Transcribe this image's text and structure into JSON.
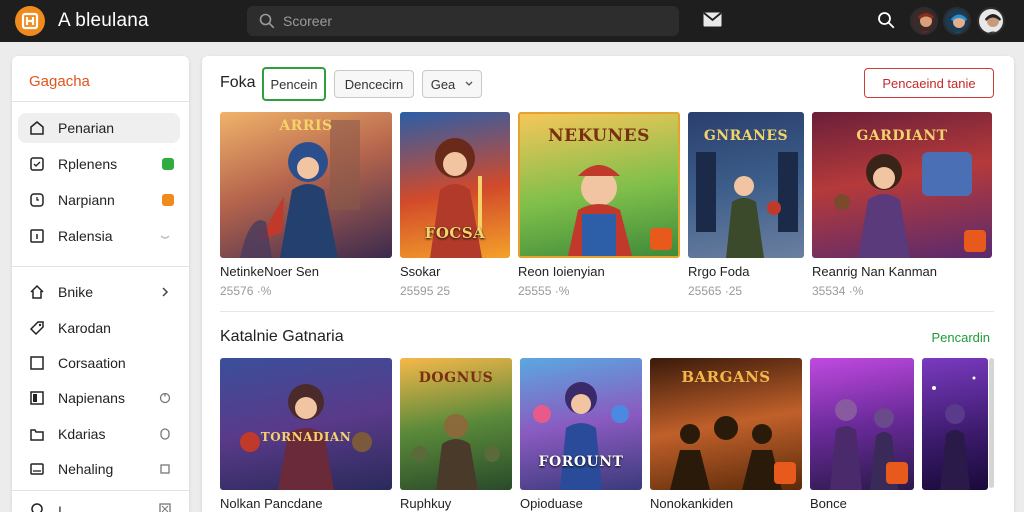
{
  "header": {
    "app_title": "A bleulana",
    "search_placeholder": "Scoreer",
    "icons": [
      "mail-icon",
      "search-icon"
    ],
    "avatars": [
      "avatar-1",
      "avatar-2",
      "avatar-3"
    ]
  },
  "sidebar": {
    "title": "Gagacha",
    "items": [
      {
        "label": "Penarian",
        "icon": "home-icon",
        "active": true
      },
      {
        "label": "Rplenens",
        "icon": "square-check-icon",
        "badge_color": "#2fae3f"
      },
      {
        "label": "Narpiann",
        "icon": "clock-icon",
        "badge_color": "#f08a1c"
      },
      {
        "label": "Ralensia",
        "icon": "info-square-icon",
        "trail": "toggle-icon"
      },
      {
        "label": "Bnike",
        "icon": "house-icon",
        "trail": "chevron-right-icon"
      },
      {
        "label": "Karodan",
        "icon": "tag-icon"
      },
      {
        "label": "Corsaation",
        "icon": "square-icon"
      },
      {
        "label": "Napienans",
        "icon": "book-icon",
        "trail": "refresh-icon"
      },
      {
        "label": "Kdarias",
        "icon": "folder-icon",
        "trail": "circle-icon"
      },
      {
        "label": "Nehaling",
        "icon": "image-icon",
        "trail": "square-outline-icon"
      }
    ],
    "bottom_item": {
      "label": "ı"
    }
  },
  "main": {
    "section1": {
      "title": "Foka",
      "tabs": [
        {
          "label": "Pencein",
          "active": true
        },
        {
          "label": "Dencecirn"
        },
        {
          "label": "Gea",
          "dropdown": true
        }
      ],
      "action_button": "Pencaeind tanie",
      "cards": [
        {
          "name": "NetinkeNoer Sen",
          "meta": "25576 ·%",
          "art": "ARRIS"
        },
        {
          "name": "Ssokar",
          "meta": "25595 25",
          "art": "FOCSA"
        },
        {
          "name": "Reon Ioienyian",
          "meta": "25555 ·%",
          "art": "NEKUNES"
        },
        {
          "name": "Rrgo Foda",
          "meta": "25565 ·25",
          "art": "GNRANES"
        },
        {
          "name": "Reanrig Nan Kanman",
          "meta": "35534 ·%",
          "art": "GARDIANT"
        }
      ]
    },
    "section2": {
      "title": "Katalnie Gatnaria",
      "link": "Pencardin",
      "cards": [
        {
          "name": "Nolkan Pancdane",
          "art": "TORNADIAN"
        },
        {
          "name": "Ruphkuy",
          "art": "DOGNUS"
        },
        {
          "name": "Opioduase",
          "art": "FOROUNT"
        },
        {
          "name": "Nonokankiden",
          "art": "BARGANS"
        },
        {
          "name": "Bonce",
          "art": ""
        }
      ]
    }
  },
  "colors": {
    "topbar": "#1e1e1e",
    "accent_orange": "#f08a1c",
    "sidebar_title": "#e3541c",
    "active_tab_border": "#2f9e3f",
    "action_button": "#d13b3b",
    "link_green": "#1f9a39"
  }
}
